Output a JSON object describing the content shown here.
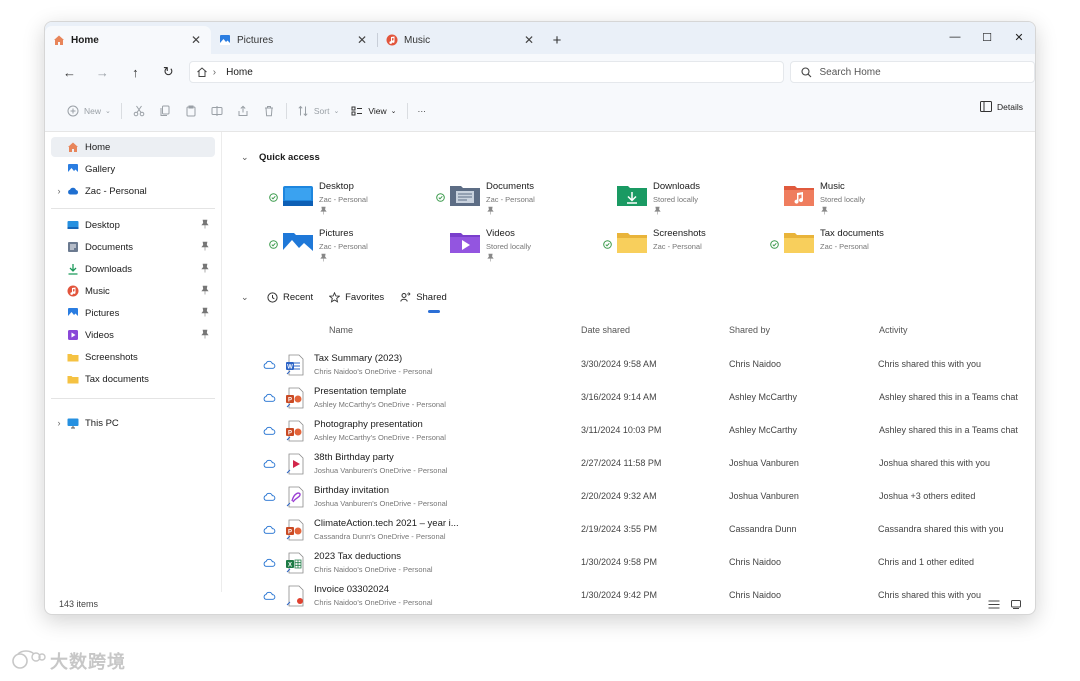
{
  "tabs": [
    {
      "label": "Home",
      "icon": "home-icon",
      "close": "✕"
    },
    {
      "label": "Pictures",
      "icon": "pictures-icon",
      "close": "✕"
    },
    {
      "label": "Music",
      "icon": "music-icon",
      "close": "✕"
    }
  ],
  "new_tab": "+",
  "window_controls": {
    "minimize": "—",
    "maximize": "☐",
    "close": "✕"
  },
  "nav": {
    "back": "←",
    "forward": "→",
    "up": "↑",
    "refresh": "↻"
  },
  "address": {
    "crumb_sep": "›",
    "location": "Home"
  },
  "search": {
    "placeholder": "Search Home"
  },
  "commands": {
    "new": "New",
    "sort": "Sort",
    "view": "View",
    "more": "···",
    "details": "Details",
    "chevron": "⌄"
  },
  "sidebar": {
    "expand": "›",
    "top": [
      {
        "label": "Home",
        "icon": "home-icon"
      },
      {
        "label": "Gallery",
        "icon": "gallery-icon"
      },
      {
        "label": "Zac - Personal",
        "icon": "onedrive-icon"
      }
    ],
    "pinned": [
      {
        "label": "Desktop",
        "icon": "desktop-icon"
      },
      {
        "label": "Documents",
        "icon": "documents-icon"
      },
      {
        "label": "Downloads",
        "icon": "downloads-icon"
      },
      {
        "label": "Music",
        "icon": "music-icon"
      },
      {
        "label": "Pictures",
        "icon": "pictures-icon"
      },
      {
        "label": "Videos",
        "icon": "videos-icon"
      },
      {
        "label": "Screenshots",
        "icon": "folder-icon"
      },
      {
        "label": "Tax documents",
        "icon": "folder-icon"
      }
    ],
    "this_pc": {
      "label": "This PC",
      "icon": "monitor-icon"
    }
  },
  "quick_access": {
    "title": "Quick access",
    "collapse": "⌄",
    "items": [
      {
        "name": "Desktop",
        "sub": "Zac - Personal",
        "icon": "desktop-folder-icon"
      },
      {
        "name": "Documents",
        "sub": "Zac - Personal",
        "icon": "documents-folder-icon"
      },
      {
        "name": "Downloads",
        "sub": "Stored locally",
        "icon": "downloads-folder-icon"
      },
      {
        "name": "Music",
        "sub": "Stored locally",
        "icon": "music-folder-icon"
      },
      {
        "name": "Pictures",
        "sub": "Zac - Personal",
        "icon": "pictures-folder-icon"
      },
      {
        "name": "Videos",
        "sub": "Stored locally",
        "icon": "videos-folder-icon"
      },
      {
        "name": "Screenshots",
        "sub": "Zac - Personal",
        "icon": "folder-icon"
      },
      {
        "name": "Tax documents",
        "sub": "Zac - Personal",
        "icon": "folder-icon"
      }
    ]
  },
  "file_tabs": {
    "collapse": "⌄",
    "recent": "Recent",
    "favorites": "Favorites",
    "shared": "Shared"
  },
  "columns": {
    "name": "Name",
    "date": "Date shared",
    "by": "Shared by",
    "activity": "Activity"
  },
  "files": [
    {
      "name": "Tax Summary (2023)",
      "location": "Chris Naidoo's OneDrive - Personal",
      "date": "3/30/2024 9:58 AM",
      "by": "Chris Naidoo",
      "activity": "Chris shared this with you",
      "icon": "word-file-icon"
    },
    {
      "name": "Presentation template",
      "location": "Ashley McCarthy's OneDrive - Personal",
      "date": "3/16/2024 9:14 AM",
      "by": "Ashley McCarthy",
      "activity": "Ashley shared this in a Teams chat",
      "icon": "powerpoint-file-icon"
    },
    {
      "name": "Photography presentation",
      "location": "Ashley McCarthy's OneDrive - Personal",
      "date": "3/11/2024 10:03 PM",
      "by": "Ashley McCarthy",
      "activity": "Ashley shared this in a Teams chat",
      "icon": "powerpoint-file-icon"
    },
    {
      "name": "38th Birthday party",
      "location": "Joshua Vanburen's OneDrive - Personal",
      "date": "2/27/2024 11:58 PM",
      "by": "Joshua Vanburen",
      "activity": "Joshua shared this with you",
      "icon": "video-file-icon"
    },
    {
      "name": "Birthday invitation",
      "location": "Joshua Vanburen's OneDrive - Personal",
      "date": "2/20/2024 9:32 AM",
      "by": "Joshua Vanburen",
      "activity": "Joshua +3 others edited",
      "icon": "design-file-icon"
    },
    {
      "name": "ClimateAction.tech 2021 – year i...",
      "location": "Cassandra Dunn's OneDrive - Personal",
      "date": "2/19/2024 3:55 PM",
      "by": "Cassandra Dunn",
      "activity": "Cassandra shared this with you",
      "icon": "powerpoint-file-icon"
    },
    {
      "name": "2023 Tax deductions",
      "location": "Chris Naidoo's OneDrive - Personal",
      "date": "1/30/2024 9:58 PM",
      "by": "Chris Naidoo",
      "activity": "Chris and 1 other edited",
      "icon": "excel-file-icon"
    },
    {
      "name": "Invoice 03302024",
      "location": "Chris Naidoo's OneDrive - Personal",
      "date": "1/30/2024 9:42 PM",
      "by": "Chris Naidoo",
      "activity": "Chris shared this with you",
      "icon": "pdf-file-icon"
    }
  ],
  "status": {
    "count": "143 items"
  },
  "watermark": {
    "text": "大数跨境"
  },
  "colors": {
    "accent": "#2b6fd6",
    "folder_yellow": "#f5c242",
    "check_green": "#3a9a4b"
  }
}
